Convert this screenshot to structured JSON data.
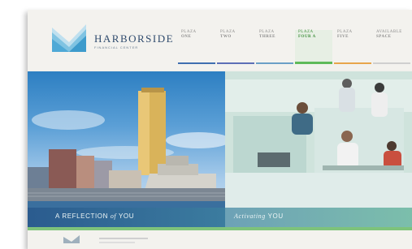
{
  "brand": {
    "name": "HARBORSIDE",
    "subtitle": "FINANCIAL CENTER",
    "accent": "#2f4b6d"
  },
  "nav": {
    "items": [
      {
        "line1": "PLAZA",
        "line2": "ONE",
        "color": "#3f6fb0"
      },
      {
        "line1": "PLAZA",
        "line2": "TWO",
        "color": "#5c6fb6"
      },
      {
        "line1": "PLAZA",
        "line2": "THREE",
        "color": "#6a9fc6"
      },
      {
        "line1": "PLAZA",
        "line2": "FOUR A",
        "color": "#5fba5a",
        "active": true
      },
      {
        "line1": "PLAZA",
        "line2": "FIVE",
        "color": "#e8a64b"
      },
      {
        "line1": "AVAILABLE",
        "line2": "SPACE",
        "color": "#cfcfcf"
      }
    ]
  },
  "hero": {
    "left_caption_a": "A REFLECTION",
    "left_caption_b": "of",
    "left_caption_c": "YOU",
    "right_caption_a": "Activating",
    "right_caption_b": "YOU"
  },
  "colors": {
    "footer_accent": "#7ec37b"
  }
}
